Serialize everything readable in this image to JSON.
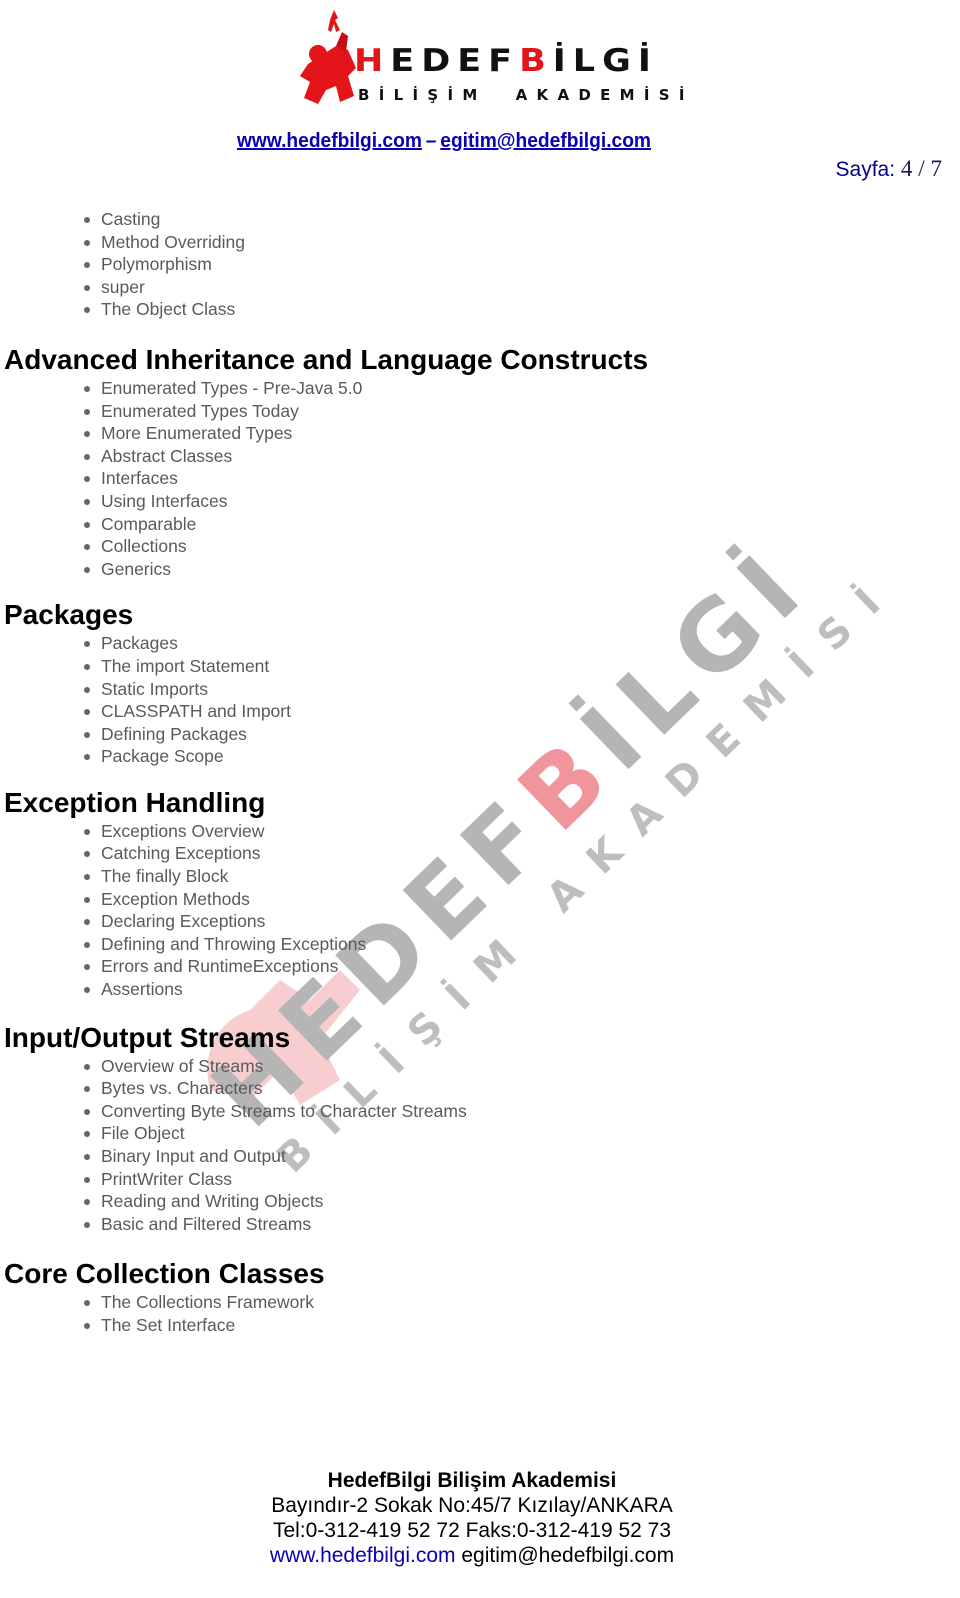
{
  "header": {
    "logo": {
      "title_prefix": "H",
      "title_mid": "EDEF",
      "title_red": "B",
      "title_suffix": "İLGİ",
      "subtitle": "BİLİŞİM  AKADEMİSİ",
      "icon": "figure-logo-icon"
    },
    "website_link": "www.hedefbilgi.com",
    "separator": "–",
    "email_link": "egitim@hedefbilgi.com",
    "page_label": "Sayfa:",
    "page_current": "4",
    "page_sep": "/",
    "page_total": "7"
  },
  "colors": {
    "brand_red": "#e4141b",
    "link_blue": "#0a00b0",
    "heading": "#000000",
    "body_text": "#5a5a5a"
  },
  "continued_items": [
    "Casting",
    "Method Overriding",
    "Polymorphism",
    "super",
    "The Object Class"
  ],
  "sections": [
    {
      "title": "Advanced Inheritance and Language Constructs",
      "items": [
        "Enumerated Types - Pre-Java 5.0",
        "Enumerated Types Today",
        "More Enumerated Types",
        "Abstract Classes",
        "Interfaces",
        "Using Interfaces",
        "Comparable",
        "Collections",
        "Generics"
      ]
    },
    {
      "title": "Packages",
      "items": [
        "Packages",
        "The import Statement",
        "Static Imports",
        "CLASSPATH and Import",
        "Defining Packages",
        "Package Scope"
      ]
    },
    {
      "title": "Exception Handling",
      "items": [
        "Exceptions Overview",
        "Catching Exceptions",
        "The finally Block",
        "Exception Methods",
        "Declaring Exceptions",
        "Defining and Throwing Exceptions",
        "Errors and RuntimeExceptions",
        "Assertions"
      ]
    },
    {
      "title": "Input/Output Streams",
      "items": [
        "Overview of Streams",
        "Bytes vs. Characters",
        "Converting Byte Streams to Character Streams",
        "File Object",
        "Binary Input and Output",
        "PrintWriter Class",
        "Reading and Writing Objects",
        "Basic and Filtered Streams"
      ]
    },
    {
      "title": "Core Collection Classes",
      "items": [
        "The Collections Framework",
        "The Set Interface"
      ]
    }
  ],
  "watermark": {
    "title_gray": "HEDEF",
    "title_red": "B",
    "title_gray2": "İLGİ",
    "subtitle": "BİLİŞİM AKADEMİSİ"
  },
  "footer": {
    "company": "HedefBilgi Bilişim Akademisi",
    "address": "Bayındır-2 Sokak No:45/7 Kızılay/ANKARA",
    "phones": "Tel:0-312-419 52 72 Faks:0-312-419 52 73",
    "website": "www.hedefbilgi.com",
    "email": "egitim@hedefbilgi.com"
  }
}
